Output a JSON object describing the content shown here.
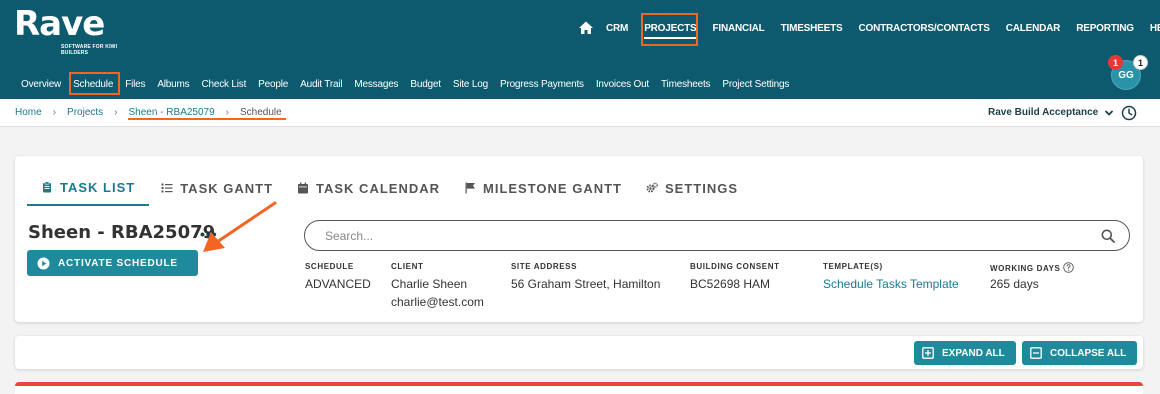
{
  "brand": {
    "name": "Rave",
    "tagline": "SOFTWARE FOR KIWI BUILDERS"
  },
  "main_nav": {
    "items": [
      {
        "label": "CRM"
      },
      {
        "label": "PROJECTS",
        "active": true
      },
      {
        "label": "FINANCIAL"
      },
      {
        "label": "TIMESHEETS"
      },
      {
        "label": "CONTRACTORS/CONTACTS"
      },
      {
        "label": "CALENDAR"
      },
      {
        "label": "REPORTING"
      },
      {
        "label": "HELP"
      }
    ]
  },
  "user": {
    "initials": "GG",
    "notification_count": "1",
    "message_count": "1"
  },
  "sub_nav": {
    "items": [
      {
        "label": "Overview"
      },
      {
        "label": "Schedule",
        "active": true
      },
      {
        "label": "Files"
      },
      {
        "label": "Albums"
      },
      {
        "label": "Check List"
      },
      {
        "label": "People"
      },
      {
        "label": "Audit Trail"
      },
      {
        "label": "Messages"
      },
      {
        "label": "Budget"
      },
      {
        "label": "Site Log"
      },
      {
        "label": "Progress Payments"
      },
      {
        "label": "Invoices Out"
      },
      {
        "label": "Timesheets"
      },
      {
        "label": "Project Settings"
      }
    ]
  },
  "breadcrumb": {
    "items": [
      {
        "label": "Home"
      },
      {
        "label": "Projects"
      },
      {
        "label": "Sheen - RBA25079"
      },
      {
        "label": "Schedule",
        "current": true
      }
    ]
  },
  "build_selector": {
    "value": "Rave Build Acceptance"
  },
  "tabs": [
    {
      "label": "TASK LIST",
      "icon": "clipboard-icon",
      "active": true
    },
    {
      "label": "TASK GANTT",
      "icon": "list-icon"
    },
    {
      "label": "TASK CALENDAR",
      "icon": "calendar-icon"
    },
    {
      "label": "MILESTONE GANTT",
      "icon": "flag-icon"
    },
    {
      "label": "SETTINGS",
      "icon": "gears-icon"
    }
  ],
  "project": {
    "title": "Sheen - RBA25079",
    "more_label": "•••"
  },
  "activate_button": {
    "label": "ACTIVATE SCHEDULE"
  },
  "search": {
    "placeholder": "Search...",
    "value": ""
  },
  "details": {
    "schedule": {
      "label": "SCHEDULE",
      "value": "ADVANCED"
    },
    "client": {
      "label": "CLIENT",
      "name": "Charlie Sheen",
      "email": "charlie@test.com"
    },
    "site_address": {
      "label": "SITE ADDRESS",
      "value": "56 Graham Street, Hamilton"
    },
    "building_consent": {
      "label": "BUILDING CONSENT",
      "value": "BC52698 HAM"
    },
    "templates": {
      "label": "TEMPLATE(S)",
      "value": "Schedule Tasks Template"
    },
    "working_days": {
      "label": "WORKING DAYS",
      "value": "265 days"
    }
  },
  "toolbar": {
    "expand_label": "EXPAND ALL",
    "collapse_label": "COLLAPSE ALL"
  },
  "colors": {
    "header": "#0d5a6e",
    "accent": "#1f8a9c",
    "highlight": "#f26522",
    "alert": "#e8473b"
  }
}
